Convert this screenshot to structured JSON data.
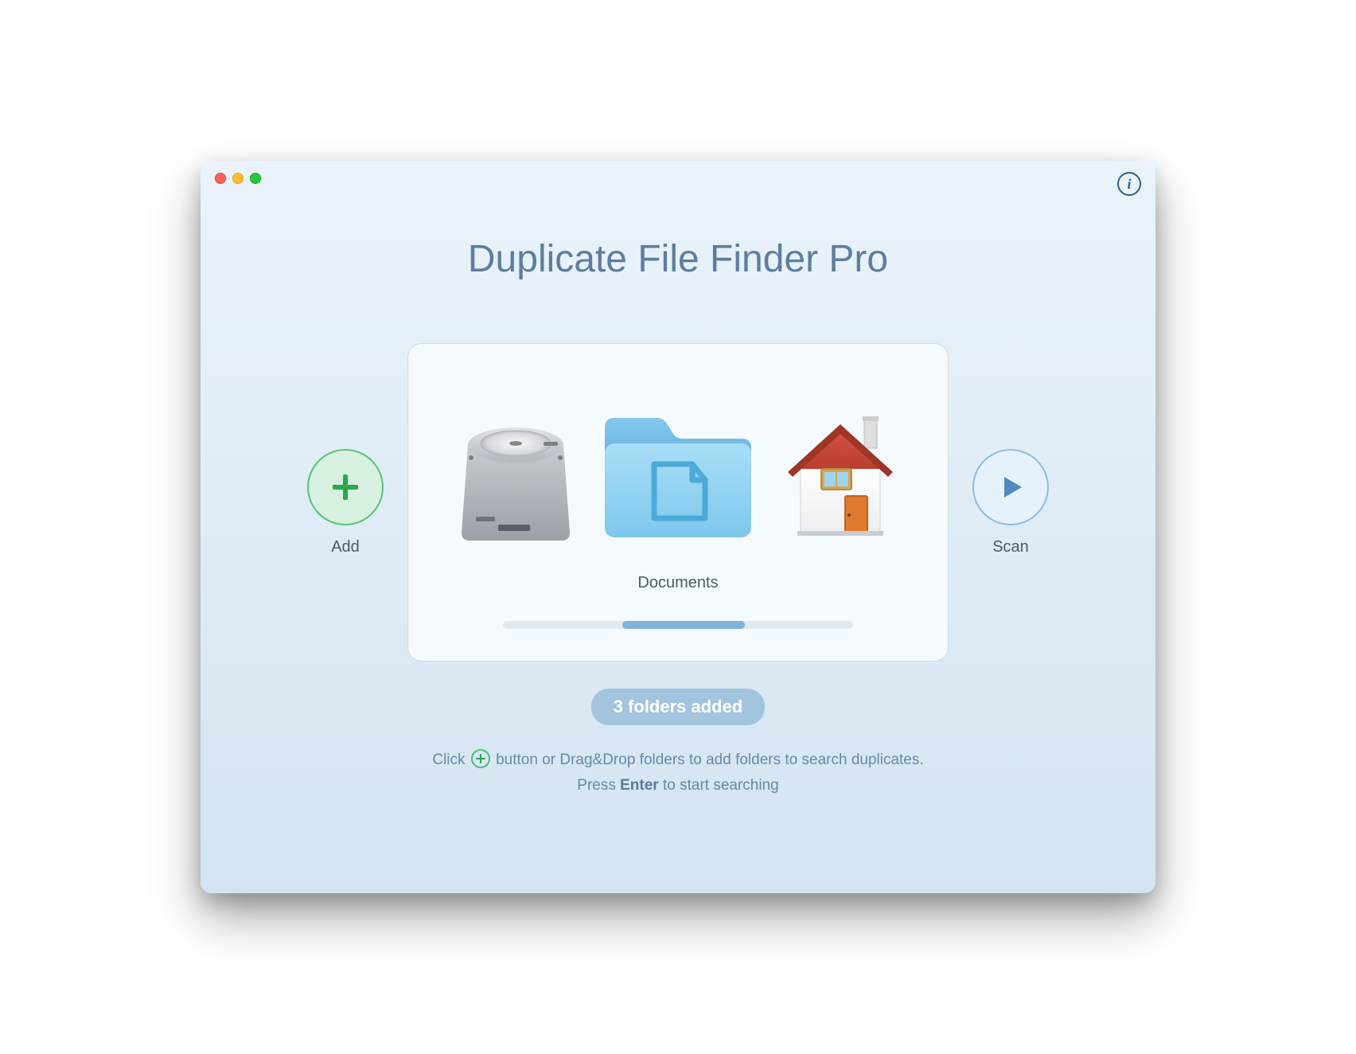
{
  "app": {
    "title": "Duplicate File Finder Pro"
  },
  "buttons": {
    "add_label": "Add",
    "scan_label": "Scan"
  },
  "card": {
    "selected_label": "Documents",
    "scrubber": {
      "thumb_left_pct": 34,
      "thumb_width_pct": 35
    }
  },
  "badge": {
    "text": "3 folders added"
  },
  "help": {
    "line1_prefix": "Click",
    "line1_suffix": "button or Drag&Drop folders to add folders to search duplicates.",
    "line2_prefix": "Press",
    "line2_key": "Enter",
    "line2_suffix": "to start searching"
  },
  "colors": {
    "title": "#5d7e9e",
    "green": "#2aa84f",
    "blue": "#4f8bc0"
  },
  "icons": {
    "disk": "disk-icon",
    "folder": "documents-folder-icon",
    "home": "home-icon"
  }
}
